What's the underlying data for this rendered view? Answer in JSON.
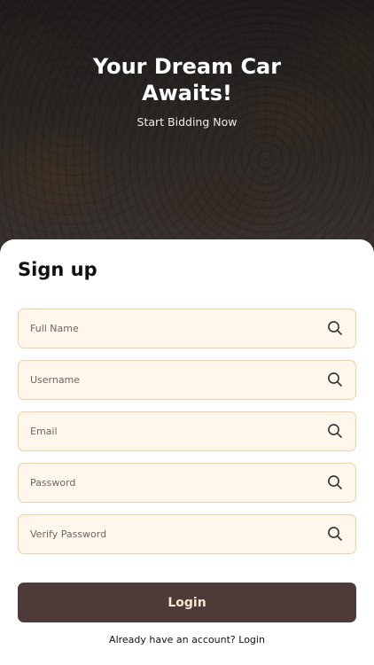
{
  "hero": {
    "title": "Your Dream Car\nAwaits!",
    "subtitle": "Start Bidding Now"
  },
  "form": {
    "heading": "Sign up",
    "fields": [
      {
        "placeholder": "Full Name",
        "icon": "search-icon"
      },
      {
        "placeholder": "Username",
        "icon": "search-icon"
      },
      {
        "placeholder": "Email",
        "icon": "search-icon"
      },
      {
        "placeholder": "Password",
        "icon": "search-icon"
      },
      {
        "placeholder": "Verify Password",
        "icon": "search-icon"
      }
    ],
    "submit_label": "Login",
    "footer_text": "Already have an account? Login"
  },
  "colors": {
    "field_bg": "#fff6ec",
    "field_border": "#f3cfa3",
    "button_bg": "#4d3b39",
    "button_text": "#f5e6cf"
  }
}
